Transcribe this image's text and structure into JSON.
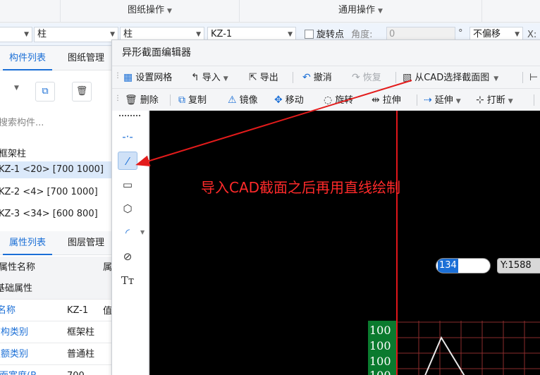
{
  "top": {
    "group1": "图纸操作",
    "group2": "通用操作"
  },
  "selection": {
    "combo1": "",
    "combo2": "柱",
    "combo3": "柱",
    "combo4": "KZ-1",
    "rotate_point": "旋转点",
    "angle_label": "角度:",
    "angle_value": "0",
    "degree": "°",
    "offset": "不偏移",
    "x_label": "X:"
  },
  "left_panel": {
    "tabs": [
      "构件列表",
      "图纸管理"
    ],
    "search_placeholder": "搜索构件...",
    "group_name": "框架柱",
    "components": [
      "KZ-1 <20> [700 1000]",
      "KZ-2 <4> [700 1000]",
      "KZ-3 <34> [600 800]"
    ],
    "prop_tabs": [
      "属性列表",
      "图层管理"
    ],
    "prop_header": [
      "属性名称",
      "属性值"
    ],
    "prop_group": "基础属性",
    "props": [
      {
        "name": "名称",
        "value": "KZ-1"
      },
      {
        "name": "结构类别",
        "value": "框架柱"
      },
      {
        "name": "定额类别",
        "value": "普通柱"
      },
      {
        "name": "截面宽度(B",
        "value": "700"
      }
    ]
  },
  "dialog": {
    "title": "异形截面编辑器",
    "toolbar1": {
      "grid": "设置网格",
      "import": "导入",
      "export": "导出",
      "undo": "撤消",
      "redo": "恢复",
      "from_cad": "从CAD选择截面图"
    },
    "toolbar2": {
      "delete": "删除",
      "copy": "复制",
      "mirror": "镜像",
      "move": "移动",
      "rotate": "旋转",
      "stretch": "拉伸",
      "extend": "延伸",
      "break": "打断"
    },
    "tools": [
      "point-tool",
      "line-tool",
      "rect-tool",
      "polygon-tool",
      "arc-tool",
      "circle-tool",
      "text-tool"
    ],
    "annotation": "导入CAD截面之后再用直线绘制",
    "x_input": "134",
    "y_badge": "Y:1588",
    "ruler_labels": [
      "100",
      "100",
      "100",
      "100"
    ]
  },
  "colors": {
    "accent": "#1b6fd6",
    "canvas": "#000000",
    "annotation": "#ff2a2a",
    "axis": "#e0161b"
  }
}
